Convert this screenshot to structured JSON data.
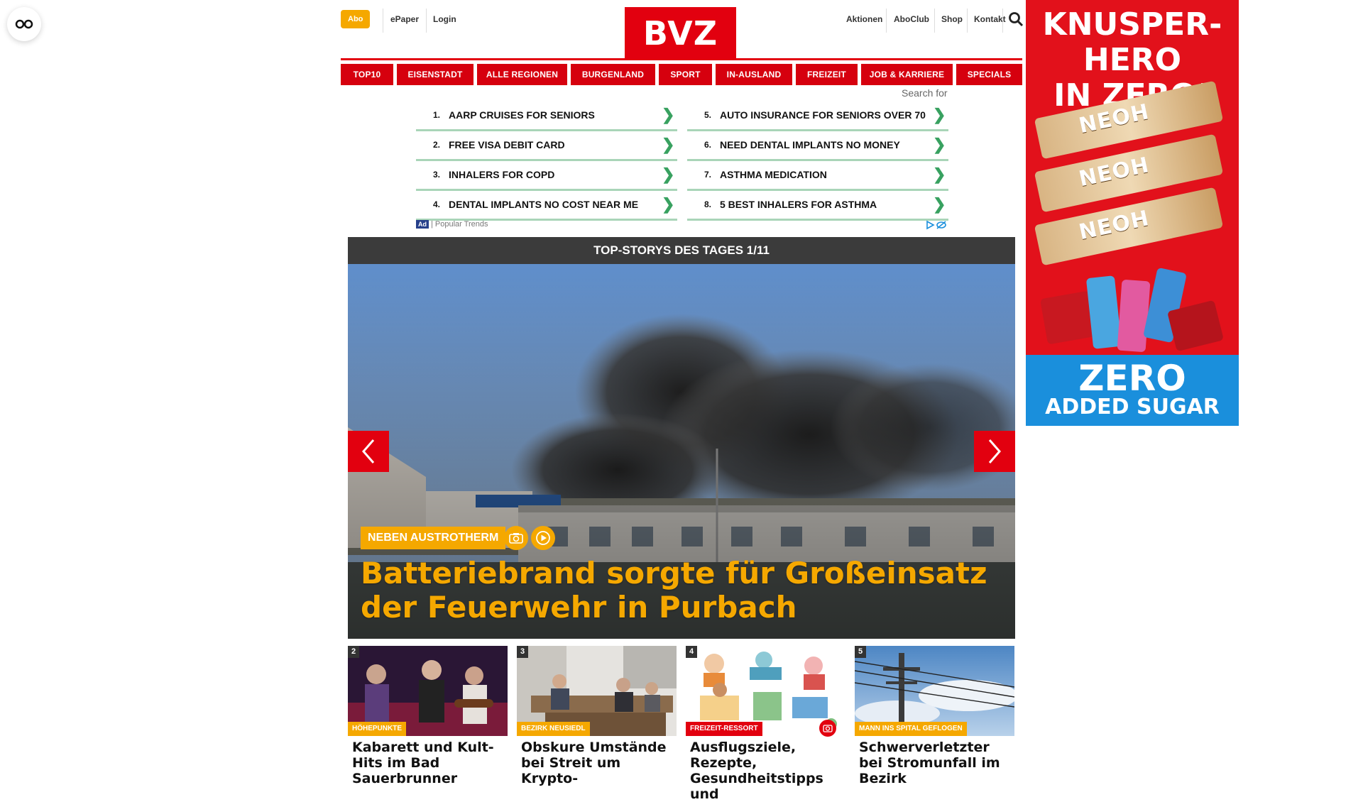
{
  "header": {
    "abo_label": "Abo",
    "epaper_label": "ePaper",
    "login_label": "Login",
    "logo_text": "BVZ",
    "aktionen_label": "Aktionen",
    "aboclub_label": "AboClub",
    "shop_label": "Shop",
    "kontakt_label": "Kontakt"
  },
  "nav": [
    "TOP10",
    "EISENSTADT",
    "ALLE REGIONEN",
    "BURGENLAND",
    "SPORT",
    "IN-AUSLAND",
    "FREIZEIT",
    "JOB & KARRIERE",
    "SPECIALS"
  ],
  "ad_block": {
    "search_for": "Search for",
    "left": [
      {
        "num": "1.",
        "text": "AARP CRUISES FOR SENIORS"
      },
      {
        "num": "2.",
        "text": "FREE VISA DEBIT CARD"
      },
      {
        "num": "3.",
        "text": "INHALERS FOR COPD"
      },
      {
        "num": "4.",
        "text": "DENTAL IMPLANTS NO COST NEAR ME"
      }
    ],
    "right": [
      {
        "num": "5.",
        "text": "AUTO INSURANCE FOR SENIORS OVER 70"
      },
      {
        "num": "6.",
        "text": "NEED DENTAL IMPLANTS NO MONEY"
      },
      {
        "num": "7.",
        "text": "ASTHMA MEDICATION"
      },
      {
        "num": "8.",
        "text": "5 BEST INHALERS FOR ASTHMA"
      }
    ],
    "chevron": "❯",
    "badge": "Ad",
    "footer_label": "| Popular Trends"
  },
  "top_stories": {
    "header": "TOP-STORYS DES TAGES 1/11",
    "hero_tag": "NEBEN AUSTROTHERM",
    "hero_title": "Batteriebrand sorgte für Großeinsatz der Feuerwehr in Purbach",
    "cards": [
      {
        "num": "2",
        "tag": "HÖHEPUNKTE",
        "tag_color": "#f5a800",
        "title": "Kabarett und Kult-Hits im Bad Sauerbrunner"
      },
      {
        "num": "3",
        "tag": "BEZIRK NEUSIEDL",
        "tag_color": "#f5a800",
        "title": "Obskure Umstände bei Streit um Krypto-"
      },
      {
        "num": "4",
        "tag": "FREIZEIT-RESSORT",
        "tag_color": "#e2000f",
        "title": "Ausflugsziele, Rezepte, Gesundheitstipps und"
      },
      {
        "num": "5",
        "tag": "MANN INS SPITAL GEFLOGEN",
        "tag_color": "#f5a800",
        "title": "Schwerverletzter bei Stromunfall im Bezirk"
      }
    ]
  },
  "side_ad": {
    "headline_1": "KNUSPER-HERO",
    "headline_2": "IN ZERO!",
    "product": "NEOH",
    "zero": "ZERO",
    "sugar": "ADDED SUGAR"
  },
  "colors": {
    "brand_red": "#e2000f",
    "accent_yellow": "#f5a800",
    "dark_bar": "#3b3b3b"
  }
}
